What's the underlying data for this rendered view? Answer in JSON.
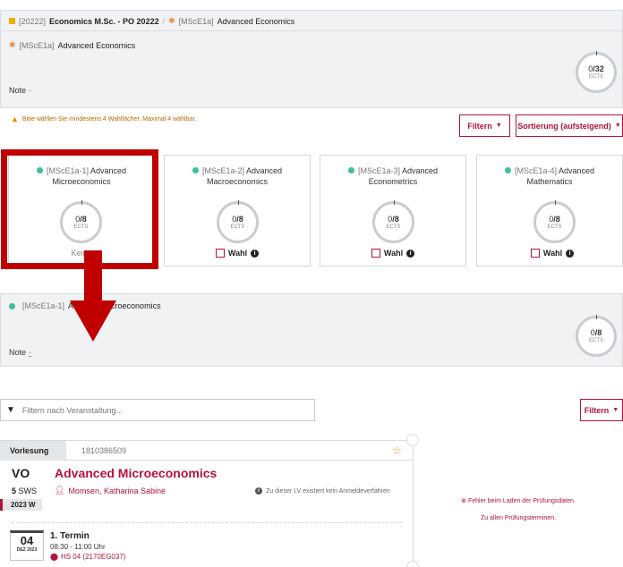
{
  "breadcrumb": {
    "code": "[20222]",
    "program": "Economics M.Sc. - PO 20222",
    "separator": "/",
    "module_code": "[MScE1a]",
    "module_name": "Advanced Economics"
  },
  "module": {
    "code": "[MScE1a]",
    "name": "Advanced Economics",
    "note_label": "Note",
    "note_value": "-",
    "ects_current": "0",
    "ects_total": "/32",
    "ects_unit": "ECTS"
  },
  "warning": "Bitte wählen Sie mindestens 4 Wahlfächer. Maximal 4 wählbar.",
  "buttons": {
    "filter": "Filtern",
    "sort": "Sortierung (aufsteigend)",
    "filter2": "Filtern"
  },
  "cards": [
    {
      "code": "[MScE1a-1]",
      "name": "Advanced Microeconomics",
      "ects": "0",
      "ects_total": "/8",
      "unit": "ECTS",
      "status": "Keine"
    },
    {
      "code": "[MScE1a-2]",
      "name": "Advanced Macroeconomics",
      "ects": "0",
      "ects_total": "/8",
      "unit": "ECTS",
      "wahl": "Wahl"
    },
    {
      "code": "[MScE1a-3]",
      "name": "Advanced Econometrics",
      "ects": "0",
      "ects_total": "/8",
      "unit": "ECTS",
      "wahl": "Wahl"
    },
    {
      "code": "[MScE1a-4]",
      "name": "Advanced Mathematics",
      "ects": "0",
      "ects_total": "/8",
      "unit": "ECTS",
      "wahl": "Wahl"
    }
  ],
  "submodule": {
    "code": "[MScE1a-1]",
    "name_visible_left": "Adva",
    "name_visible_right": "Microeconomics",
    "note_label": "Note",
    "note_value": "-",
    "ects": "0",
    "ects_total": "/8",
    "unit": "ECTS"
  },
  "filter_input": {
    "placeholder": "Filtern nach Veranstaltung..."
  },
  "course": {
    "tab": "Vorlesung",
    "number": "1810386509",
    "type": "VO",
    "title": "Advanced Microeconomics",
    "sws_value": "5",
    "sws_label": "SWS",
    "lecturer": "Momsen, Katharina Sabine",
    "no_registration": "Zu dieser LV existiert kein Anmeldeverfahren",
    "semester": "2023 W",
    "date_day": "04",
    "date_month": "DEZ 2023",
    "termin": "1. Termin",
    "time": "08:30 - 11:00 Uhr",
    "room": "HS 04 (2170EG037)"
  },
  "exam": {
    "error": "Fehler beim Laden der Prüfungsdaten.",
    "link": "Zu allen Prüfungsterminen."
  },
  "colors": {
    "accent": "#b5123a",
    "highlight": "#c00000",
    "status_dot": "#3cbf9f",
    "warning": "#b86b00"
  },
  "icons": [
    "folder-square-icon",
    "module-star-icon",
    "warning-icon",
    "caret-down-icon",
    "status-dot-icon",
    "checkbox-icon",
    "info-icon",
    "funnel-icon",
    "favorite-star-icon",
    "person-icon",
    "map-pin-icon",
    "error-circle-icon"
  ]
}
